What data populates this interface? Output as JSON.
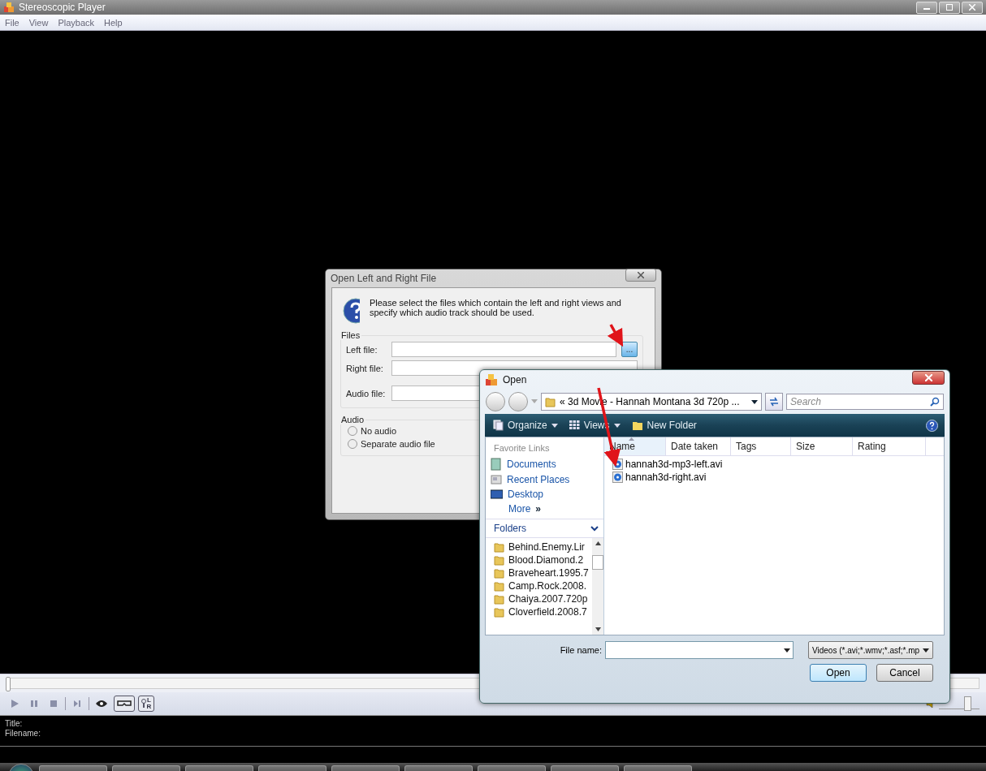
{
  "window": {
    "title": "Stereoscopic Player"
  },
  "menu": [
    "File",
    "View",
    "Playback",
    "Help"
  ],
  "player": {
    "seek": {
      "level": 0
    },
    "controls": [
      {
        "kind": "play"
      },
      {
        "kind": "pause"
      },
      {
        "kind": "stop"
      },
      {
        "kind": "sep"
      },
      {
        "kind": "next"
      },
      {
        "kind": "sep"
      }
    ],
    "toggles": [
      {
        "kind": "eye",
        "pressed": false
      },
      {
        "kind": "glasses",
        "pressed": true
      },
      {
        "kind": "lr",
        "pressed": true
      }
    ],
    "lr_letters": [
      "L",
      "R"
    ],
    "volume": {
      "level": 0.7
    },
    "info": [
      "Title:",
      "Filename:"
    ]
  },
  "lr_dialog": {
    "title": "Open Left and Right File",
    "instructions": "Please select the files which contain the left and right views and specify which audio track should be used.",
    "files_group": "Files",
    "fields": [
      {
        "label": "Left file:",
        "browse": "..."
      },
      {
        "label": "Right file:"
      },
      {
        "label": "Audio file:"
      }
    ],
    "audio_group": "Audio",
    "radios": [
      {
        "label": "No audio",
        "selected": false
      },
      {
        "label": "Separate audio file",
        "selected": false
      }
    ]
  },
  "open_dialog": {
    "title": "Open",
    "address": "« 3d Movie - Hannah Montana 3d 720p ...",
    "search": {
      "placeholder": "Search"
    },
    "toolbar": [
      "Organize",
      "Views",
      "New Folder"
    ],
    "favorites_header": "Favorite Links",
    "favorites": [
      "Documents",
      "Recent Places",
      "Desktop"
    ],
    "more": "More",
    "more_glyph": "»",
    "folders_header": "Folders",
    "folders": [
      "Behind.Enemy.Lir",
      "Blood.Diamond.2",
      "Braveheart.1995.7",
      "Camp.Rock.2008.",
      "Chaiya.2007.720p",
      "Cloverfield.2008.7"
    ],
    "columns": [
      "Name",
      "Date taken",
      "Tags",
      "Size",
      "Rating"
    ],
    "files": [
      {
        "name": "hannah3d-mp3-left.avi",
        "selected": false
      },
      {
        "name": "hannah3d-right.avi",
        "selected": false
      }
    ],
    "filename_label": "File name:",
    "filetype": "Videos (*.avi;*.wmv;*.asf;*.mp",
    "buttons": [
      "Open",
      "Cancel"
    ]
  }
}
